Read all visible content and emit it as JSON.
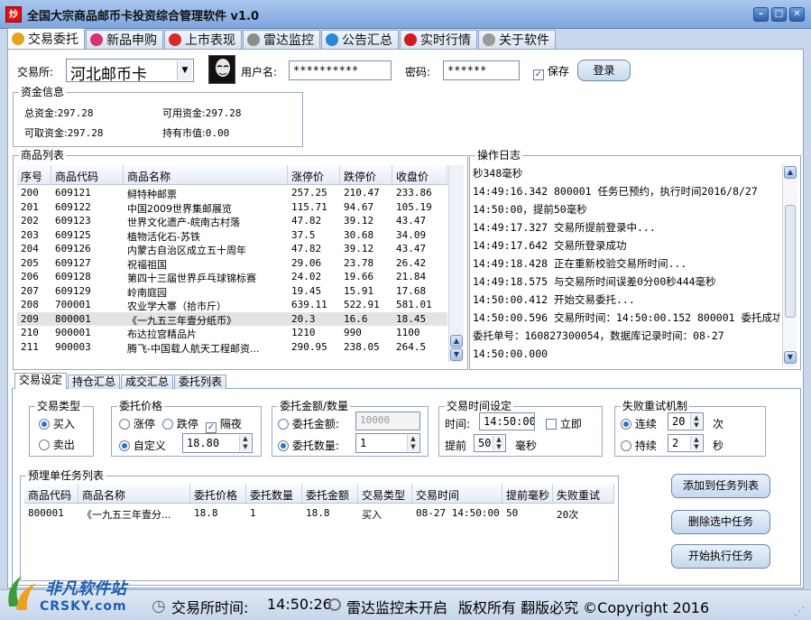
{
  "window": {
    "title": "全国大宗商品邮币卡投资综合管理软件 v1.0",
    "icon_text": "炒"
  },
  "main_tabs": [
    {
      "label": "交易委托",
      "icon": "coin-icon",
      "color": "#e8a21b",
      "active": true
    },
    {
      "label": "新品申购",
      "icon": "gift-icon",
      "color": "#d9326e",
      "active": false
    },
    {
      "label": "上市表现",
      "icon": "trend-chart-icon",
      "color": "#d72b2b",
      "active": false
    },
    {
      "label": "雷达监控",
      "icon": "radar-icon",
      "color": "#8c8c8c",
      "active": false
    },
    {
      "label": "公告汇总",
      "icon": "signal-icon",
      "color": "#2a88d6",
      "active": false
    },
    {
      "label": "实时行情",
      "icon": "alarm-clock-icon",
      "color": "#d11a1a",
      "active": false
    },
    {
      "label": "关于软件",
      "icon": "info-icon",
      "color": "#9a9a9a",
      "active": false
    }
  ],
  "login": {
    "exchange_label": "交易所:",
    "exchange_value": "河北邮币卡",
    "username_label": "用户名:",
    "username_value": "**********",
    "password_label": "密码:",
    "password_value": "******",
    "save_label": "保存",
    "save_checked": true,
    "login_button": "登录"
  },
  "funds": {
    "title": "资金信息",
    "total_label": "总资金:",
    "total_value": "297.28",
    "available_label": "可用资金:",
    "available_value": "297.28",
    "withdrawable_label": "可取资金:",
    "withdrawable_value": "297.28",
    "market_value_label": "持有市值:",
    "market_value_value": "0.00"
  },
  "product_list": {
    "title": "商品列表",
    "columns": [
      "序号",
      "商品代码",
      "商品名称",
      "涨停价",
      "跌停价",
      "收盘价"
    ],
    "rows": [
      [
        "200",
        "609121",
        "鲟特种邮票",
        "257.25",
        "210.47",
        "233.86"
      ],
      [
        "201",
        "609122",
        "中国2009世界集邮展览",
        "115.71",
        "94.67",
        "105.19"
      ],
      [
        "202",
        "609123",
        "世界文化遗产-皖南古村落",
        "47.82",
        "39.12",
        "43.47"
      ],
      [
        "203",
        "609125",
        "植物活化石-苏铁",
        "37.5",
        "30.68",
        "34.09"
      ],
      [
        "204",
        "609126",
        "内蒙古自治区成立五十周年",
        "47.82",
        "39.12",
        "43.47"
      ],
      [
        "205",
        "609127",
        "祝福祖国",
        "29.06",
        "23.78",
        "26.42"
      ],
      [
        "206",
        "609128",
        "第四十三届世界乒乓球锦标赛",
        "24.02",
        "19.66",
        "21.84"
      ],
      [
        "207",
        "609129",
        "岭南庭园",
        "19.45",
        "15.91",
        "17.68"
      ],
      [
        "208",
        "700001",
        "农业学大寨（拾市斤）",
        "639.11",
        "522.91",
        "581.01"
      ],
      [
        "209",
        "800001",
        "《一九五三年壹分纸币》",
        "20.3",
        "16.6",
        "18.45"
      ],
      [
        "210",
        "900001",
        "布达拉宫精品片",
        "1210",
        "990",
        "1100"
      ],
      [
        "211",
        "900003",
        "腾飞-中国载人航天工程邮资...",
        "290.95",
        "238.05",
        "264.5"
      ]
    ],
    "selected_index": 9
  },
  "operation_log": {
    "title": "操作日志",
    "lines": [
      "秒348毫秒",
      "14:49:16.342 800001 任务已预约，执行时间2016/8/27",
      "14:50:00，提前50毫秒",
      "14:49:17.327 交易所提前登录中...",
      "14:49:17.642 交易所登录成功",
      "14:49:18.428 正在重新校验交易所时间...",
      "14:49:18.575 与交易所时间误差0分00秒444毫秒",
      "14:50:00.412 开始交易委托...",
      "14:50:00.596 交易所时间：14:50:00.152 800001 委托成功。",
      "委托单号：160827300054，数据库记录时间：08-27",
      "14:50:00.000",
      "",
      "14:50:01.481 任务都已完成"
    ]
  },
  "sub_tabs": [
    {
      "label": "交易设定",
      "active": true
    },
    {
      "label": "持仓汇总",
      "active": false
    },
    {
      "label": "成交汇总",
      "active": false
    },
    {
      "label": "委托列表",
      "active": false
    }
  ],
  "trade_type": {
    "title": "交易类型",
    "buy": "买入",
    "sell": "卖出",
    "selected": "buy"
  },
  "order_price": {
    "title": "委托价格",
    "limit_up": "涨停",
    "limit_down": "跌停",
    "overnight": "隔夜",
    "overnight_checked": true,
    "custom": "自定义",
    "custom_value": "18.80",
    "selected": "custom"
  },
  "order_amount": {
    "title": "委托金额/数量",
    "amount_label": "委托金额:",
    "amount_value": "10000",
    "quantity_label": "委托数量:",
    "quantity_value": "1",
    "selected": "quantity"
  },
  "trade_time": {
    "title": "交易时间设定",
    "time_label": "时间:",
    "time_value": "14:50:00",
    "immediate_label": "立即",
    "immediate_checked": false,
    "advance_label": "提前",
    "advance_value": "50",
    "advance_unit": "毫秒"
  },
  "retry": {
    "title": "失败重试机制",
    "continuous_label": "连续",
    "continuous_value": "20",
    "continuous_unit": "次",
    "sustain_label": "持续",
    "sustain_value": "2",
    "sustain_unit": "秒",
    "selected": "continuous"
  },
  "task_list": {
    "title": "预埋单任务列表",
    "columns": [
      "商品代码",
      "商品名称",
      "委托价格",
      "委托数量",
      "委托金额",
      "交易类型",
      "交易时间",
      "提前毫秒",
      "失败重试"
    ],
    "rows": [
      [
        "800001",
        "《一九五三年壹分...",
        "18.8",
        "1",
        "18.8",
        "买入",
        "08-27 14:50:00",
        "50",
        "20次"
      ]
    ]
  },
  "actions": {
    "add": "添加到任务列表",
    "delete": "删除选中任务",
    "start": "开始执行任务"
  },
  "statusbar": {
    "logo_text": "非凡软件站",
    "logo_sub": "CRSKY.com",
    "exchange_time_label": "交易所时间:",
    "exchange_time_value": "14:50:26",
    "radar_status": "雷达监控未开启",
    "copyright": "版权所有 翻版必究 ©Copyright 2016"
  }
}
